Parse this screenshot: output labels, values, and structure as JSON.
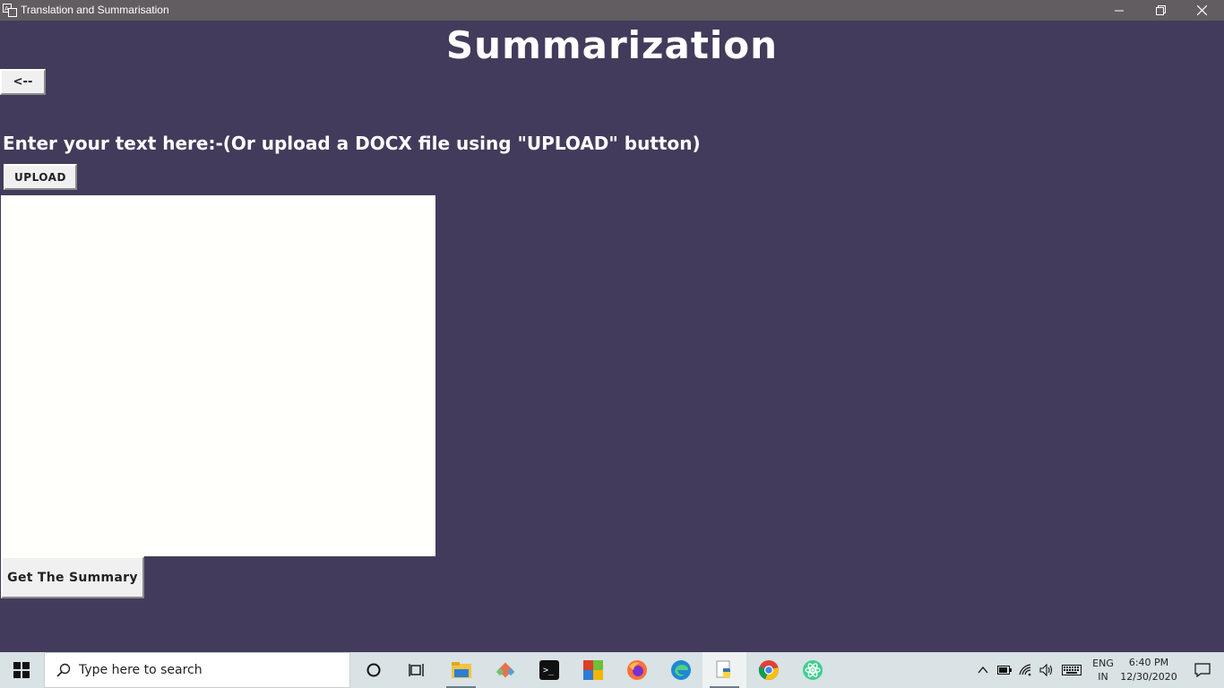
{
  "window": {
    "title": "Translation and Summarisation",
    "icons": [
      "app-icon",
      "minimize-icon",
      "restore-icon",
      "close-icon"
    ]
  },
  "app": {
    "heading": "Summarization",
    "back_label": "<--",
    "prompt": "Enter your text here:-(Or upload a DOCX file using \"UPLOAD\" button)",
    "upload_label": "UPLOAD",
    "text_value": "",
    "summary_label": "Get The Summary",
    "colors": {
      "background": "#433b5b",
      "textbox": "#fffffb",
      "titlebar": "#625d60",
      "button": "#f0f0f0"
    }
  },
  "taskbar": {
    "search_placeholder": "Type here to search",
    "pinned": [
      "cortana-icon",
      "task-view-icon",
      "file-explorer-icon",
      "git-icon",
      "terminal-icon",
      "app-icon",
      "firefox-icon",
      "edge-icon",
      "python-icon",
      "chrome-icon",
      "atom-icon"
    ],
    "tray_icons": [
      "chevron-up-icon",
      "battery-icon",
      "wifi-icon",
      "volume-icon",
      "keyboard-icon",
      "notification-icon"
    ],
    "lang_top": "ENG",
    "lang_bottom": "IN",
    "time": "6:40 PM",
    "date": "12/30/2020"
  }
}
